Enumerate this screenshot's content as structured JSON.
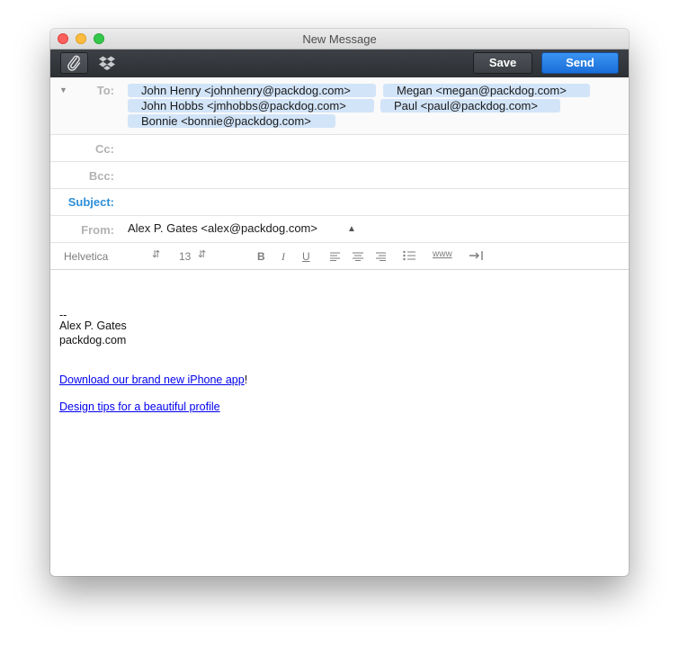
{
  "window": {
    "title": "New Message"
  },
  "toolbar": {
    "save_label": "Save",
    "send_label": "Send"
  },
  "header": {
    "to_label": "To:",
    "recipients": [
      "John Henry <johnhenry@packdog.com>",
      "Megan <megan@packdog.com>",
      "John Hobbs <jmhobbs@packdog.com>",
      "Paul <paul@packdog.com>",
      "Bonnie <bonnie@packdog.com>"
    ],
    "cc_label": "Cc:",
    "bcc_label": "Bcc:",
    "subject_label": "Subject:",
    "from_label": "From:",
    "from_value": "Alex P. Gates <alex@packdog.com>"
  },
  "format": {
    "font": "Helvetica",
    "size": "13",
    "bold": "B",
    "italic": "I",
    "underline": "U",
    "link": "www"
  },
  "body": {
    "separator": "--",
    "name": "Alex P. Gates",
    "site": "packdog.com",
    "link1_text": "Download our brand new iPhone app",
    "link1_suffix": "!",
    "link2_text": "Design tips for a beautiful profile"
  },
  "colors": {
    "send": "#1a6ed8",
    "token": "#d2e4f8",
    "subject_label": "#2d8fd8"
  }
}
